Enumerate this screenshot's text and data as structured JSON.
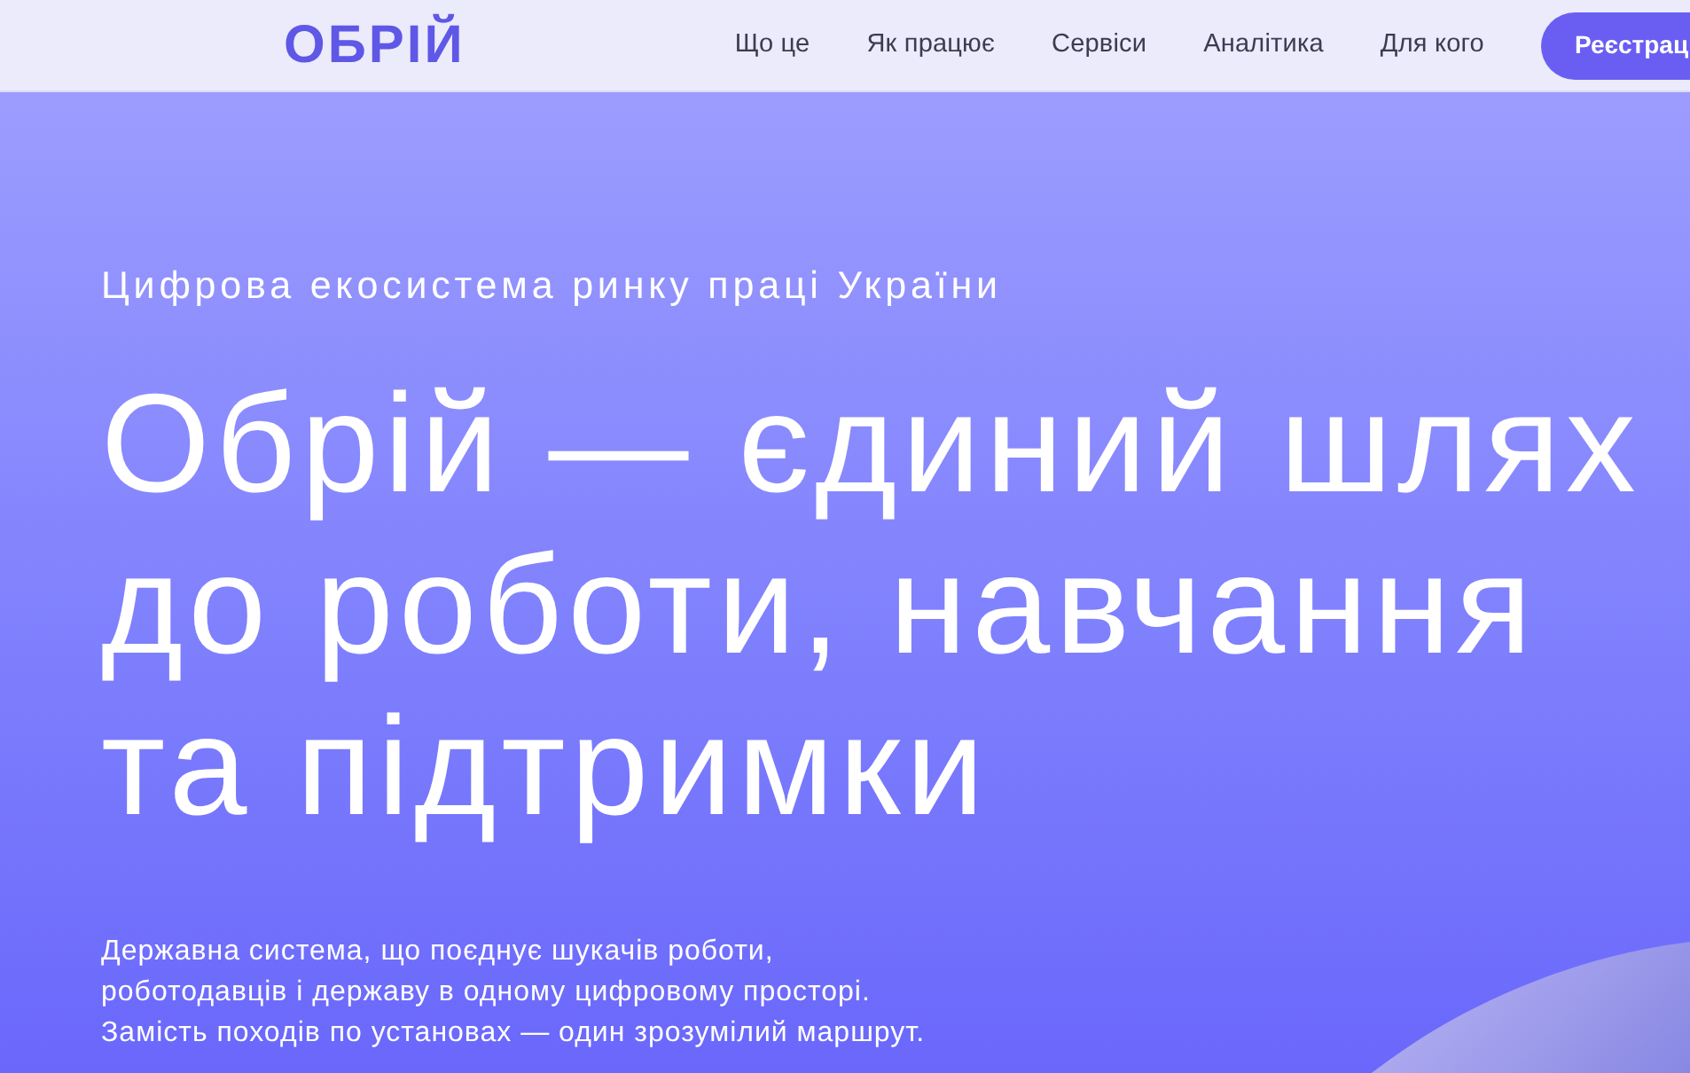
{
  "header": {
    "logo": "ОБРІЙ",
    "nav": [
      {
        "label": "Що це"
      },
      {
        "label": "Як працює"
      },
      {
        "label": "Сервіси"
      },
      {
        "label": "Аналітика"
      },
      {
        "label": "Для кого"
      }
    ],
    "cta": "Реєстрац"
  },
  "hero": {
    "eyebrow": "Цифрова екосистема ринку праці України",
    "title_lines": [
      "Обрій — єдиний шлях",
      "до роботи, навчання",
      "та підтримки"
    ],
    "description_lines": [
      "Державна система, що поєднує шукачів роботи,",
      "роботодавців і державу в одному цифровому просторі.",
      "Замість походів по установах — один зрозумілий маршрут."
    ]
  }
}
